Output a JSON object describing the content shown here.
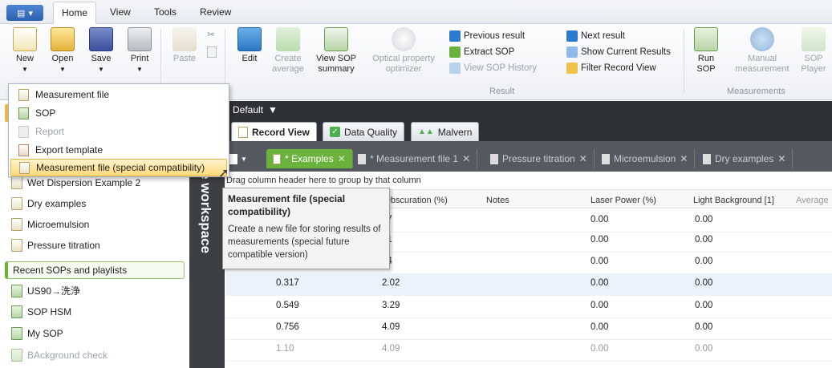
{
  "menubar": {
    "tabs": [
      "Home",
      "View",
      "Tools",
      "Review"
    ]
  },
  "ribbon": {
    "new_label": "New",
    "open_label": "Open",
    "save_label": "Save",
    "print_label": "Print",
    "paste_label": "Paste",
    "edit_label": "Edit",
    "create_average_label": "Create\naverage",
    "view_sop_summary_label": "View SOP\nsummary",
    "optical_label": "Optical property\noptimizer",
    "previous_result": "Previous result",
    "extract_sop": "Extract SOP",
    "view_sop_history": "View SOP History",
    "next_result": "Next result",
    "show_current_results": "Show Current Results",
    "filter_record_view": "Filter Record View",
    "result_group": "Result",
    "run_sop_label": "Run\nSOP",
    "manual_measurement_label": "Manual\nmeasurement",
    "sop_player_label": "SOP\nPlayer",
    "measurements_group": "Measurements"
  },
  "new_menu": {
    "items": [
      {
        "label": "Measurement file",
        "disabled": false
      },
      {
        "label": "SOP",
        "disabled": false
      },
      {
        "label": "Report",
        "disabled": true
      },
      {
        "label": "Export template",
        "disabled": false
      },
      {
        "label": "Measurement file (special compatibility)",
        "disabled": false
      }
    ]
  },
  "tooltip": {
    "title": "Measurement file (special compatibility)",
    "description": "Create a new file for storing results of measurements (special future compatible version)"
  },
  "left_panel": {
    "files": [
      "Wet Dispersion Example 2",
      "Dry examples",
      "Microemulsion",
      "Pressure titration"
    ],
    "recent_header": "Recent SOPs and playlists",
    "recent": [
      "US90→洗浄",
      "SOP HSM",
      "My SOP",
      "BAckground check"
    ]
  },
  "workspace": {
    "vertical_label": "e workspace",
    "default_label": "Default",
    "view_tabs": [
      "Record View",
      "Data Quality",
      "Malvern"
    ],
    "file_tabs": [
      "* Examples",
      "* Measurement file 1",
      "Pressure titration",
      "Microemulsion",
      "Dry examples"
    ]
  },
  "grid": {
    "group_hint": "Drag column header here to group by that column",
    "columns": [
      "ser Obscuration (%)",
      "Notes",
      "Laser Power (%)",
      "Light Background [1]",
      "Average"
    ],
    "rows": [
      [
        "",
        "07",
        "",
        "0.00",
        "0.00"
      ],
      [
        "",
        "01",
        "",
        "0.00",
        "0.00"
      ],
      [
        "",
        "04",
        "",
        "0.00",
        "0.00"
      ],
      [
        "0.317",
        "2.02",
        "",
        "0.00",
        "0.00"
      ],
      [
        "0.549",
        "3.29",
        "",
        "0.00",
        "0.00"
      ],
      [
        "0.756",
        "4.09",
        "",
        "0.00",
        "0.00"
      ],
      [
        "1.10",
        "4.09",
        "",
        "0.00",
        "0.00"
      ]
    ]
  }
}
